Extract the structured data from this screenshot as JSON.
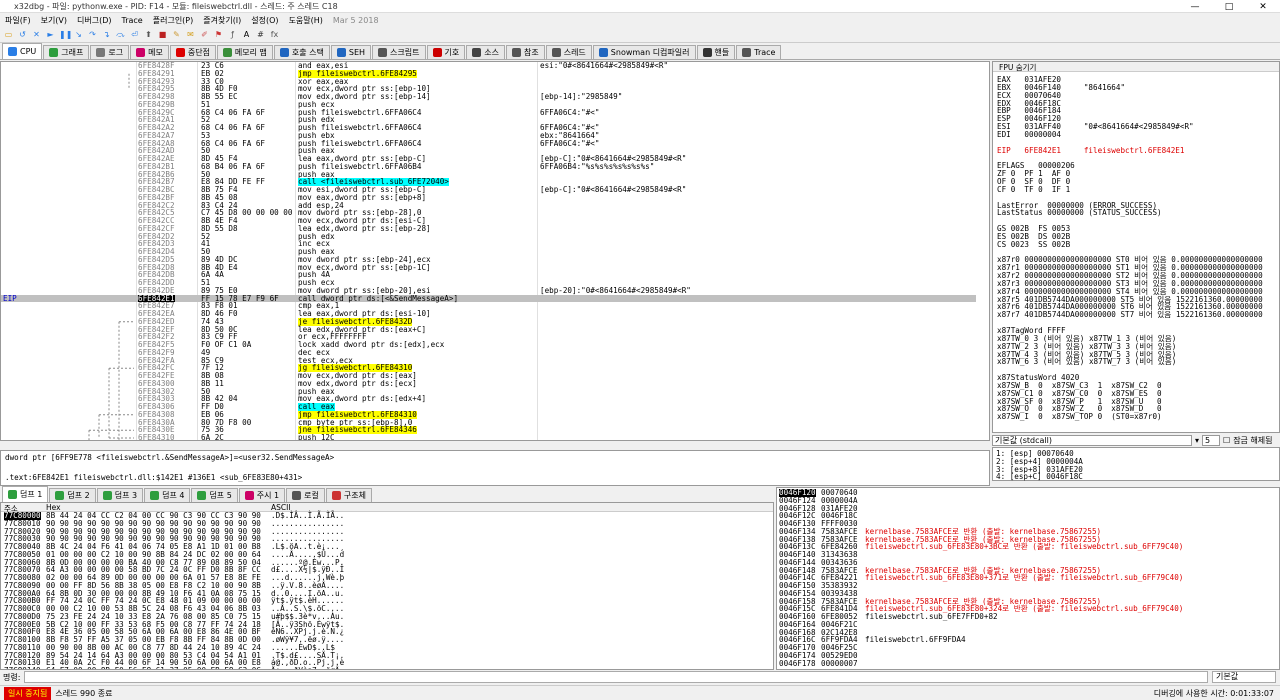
{
  "window": {
    "title": "x32dbg - 파일: pythonw.exe - PID: F14 - 모듈: fileiswebctrl.dll - 스레드: 주 스레드 C18",
    "controls": [
      "—",
      "□",
      "✕"
    ]
  },
  "menu": [
    "파일(F)",
    "보기(V)",
    "디버그(D)",
    "Trace",
    "플러그인(P)",
    "즐겨찾기(I)",
    "설정(O)",
    "도움말(H)",
    "Mar 5 2018"
  ],
  "toolbar_icons": [
    "open-icon",
    "restart-icon",
    "close-icon",
    "run-icon",
    "pause-icon",
    "step-into-icon",
    "step-over-icon",
    "trace-into-icon",
    "trace-over-icon",
    "execute-till-return-icon",
    "run-to-user-code-icon",
    "stop-icon",
    "patch-icon",
    "comment-icon",
    "label-icon",
    "bookmark-icon",
    "function-icon",
    "font-icon",
    "hash-icon",
    "fx-icon"
  ],
  "tabs": [
    {
      "label": "CPU",
      "color": "#2a7ee6"
    },
    {
      "label": "그래프",
      "color": "#2e9e3e"
    },
    {
      "label": "로그",
      "color": "#777"
    },
    {
      "label": "메모",
      "color": "#c06"
    },
    {
      "label": "중단점",
      "color": "#d00"
    },
    {
      "label": "메모리 맵",
      "color": "#3a8f3a"
    },
    {
      "label": "호출 스택",
      "color": "#2066c0"
    },
    {
      "label": "SEH",
      "color": "#2066c0"
    },
    {
      "label": "스크립트",
      "color": "#555"
    },
    {
      "label": "기호",
      "color": "#c00"
    },
    {
      "label": "소스",
      "color": "#444"
    },
    {
      "label": "참조",
      "color": "#555"
    },
    {
      "label": "스레드",
      "color": "#555"
    },
    {
      "label": "Snowman 디컴파일러",
      "color": "#2066c0"
    },
    {
      "label": "핸들",
      "color": "#333"
    },
    {
      "label": "Trace",
      "color": "#555"
    }
  ],
  "disasm": [
    [
      "6FE8428F",
      "23 C6",
      "and eax,esi",
      "esi:\"0#<8641664#<2985849#<R\"",
      ""
    ],
    [
      "6FE84291",
      "EB 02",
      "jmp fileiswebctrl.6FE84295",
      "",
      "hl"
    ],
    [
      "6FE84293",
      "33 C0",
      "xor eax,eax",
      "",
      ""
    ],
    [
      "6FE84295",
      "8B 4D F0",
      "mov ecx,dword ptr ss:[ebp-10]",
      "",
      ""
    ],
    [
      "6FE84298",
      "8B 55 EC",
      "mov edx,dword ptr ss:[ebp-14]",
      "[ebp-14]:\"2985849\"",
      ""
    ],
    [
      "6FE8429B",
      "51",
      "push ecx",
      "",
      ""
    ],
    [
      "6FE8429C",
      "68 C4 06 FA 6F",
      "push fileiswebctrl.6FFA06C4",
      "6FFA06C4:\"#<\"",
      ""
    ],
    [
      "6FE842A1",
      "52",
      "push edx",
      "",
      ""
    ],
    [
      "6FE842A2",
      "68 C4 06 FA 6F",
      "push fileiswebctrl.6FFA06C4",
      "6FFA06C4:\"#<\"",
      ""
    ],
    [
      "6FE842A7",
      "53",
      "push ebx",
      "ebx:\"8641664\"",
      ""
    ],
    [
      "6FE842A8",
      "68 C4 06 FA 6F",
      "push fileiswebctrl.6FFA06C4",
      "6FFA06C4:\"#<\"",
      ""
    ],
    [
      "6FE842AD",
      "50",
      "push eax",
      "",
      ""
    ],
    [
      "6FE842AE",
      "8D 45 F4",
      "lea eax,dword ptr ss:[ebp-C]",
      "[ebp-C]:\"0#<8641664#<2985849#<R\"",
      ""
    ],
    [
      "6FE842B1",
      "68 B4 06 FA 6F",
      "push fileiswebctrl.6FFA06B4",
      "6FFA06B4:\"%s%s%s%s%s%s%s\"",
      ""
    ],
    [
      "6FE842B6",
      "50",
      "push eax",
      "",
      ""
    ],
    [
      "6FE842B7",
      "E8 84 DD FE FF",
      "call <fileiswebctrl.sub_6FE72040>",
      "",
      "call"
    ],
    [
      "6FE842BC",
      "8B 75 F4",
      "mov esi,dword ptr ss:[ebp-C]",
      "[ebp-C]:\"0#<8641664#<2985849#<R\"",
      ""
    ],
    [
      "6FE842BF",
      "8B 45 08",
      "mov eax,dword ptr ss:[ebp+8]",
      "",
      ""
    ],
    [
      "6FE842C2",
      "83 C4 24",
      "add esp,24",
      "",
      ""
    ],
    [
      "6FE842C5",
      "C7 45 D8 00 00 00 00",
      "mov dword ptr ss:[ebp-28],0",
      "",
      ""
    ],
    [
      "6FE842CC",
      "8B 4E F4",
      "mov ecx,dword ptr ds:[esi-C]",
      "",
      ""
    ],
    [
      "6FE842CF",
      "8D 55 D8",
      "lea edx,dword ptr ss:[ebp-28]",
      "",
      ""
    ],
    [
      "6FE842D2",
      "52",
      "push edx",
      "",
      ""
    ],
    [
      "6FE842D3",
      "41",
      "inc ecx",
      "",
      ""
    ],
    [
      "6FE842D4",
      "50",
      "push eax",
      "",
      ""
    ],
    [
      "6FE842D5",
      "89 4D DC",
      "mov dword ptr ss:[ebp-24],ecx",
      "",
      ""
    ],
    [
      "6FE842D8",
      "8B 4D E4",
      "mov ecx,dword ptr ss:[ebp-1C]",
      "",
      ""
    ],
    [
      "6FE842DB",
      "6A 4A",
      "push 4A",
      "",
      ""
    ],
    [
      "6FE842DD",
      "51",
      "push ecx",
      "",
      ""
    ],
    [
      "6FE842DE",
      "89 75 E0",
      "mov dword ptr ss:[ebp-20],esi",
      "[ebp-20]:\"0#<8641664#<2985849#<R\"",
      ""
    ],
    [
      "6FE842E1",
      "FF 15 78 E7 F9 6F",
      "call dword ptr ds:[<&SendMessageA>]",
      "",
      "cur"
    ],
    [
      "6FE842E7",
      "83 F8 01",
      "cmp eax,1",
      "",
      ""
    ],
    [
      "6FE842EA",
      "8D 46 F0",
      "lea eax,dword ptr ds:[esi-10]",
      "",
      ""
    ],
    [
      "6FE842ED",
      "74 43",
      "je fileiswebctrl.6FE8432D",
      "",
      "hl"
    ],
    [
      "6FE842EF",
      "8D 50 0C",
      "lea edx,dword ptr ds:[eax+C]",
      "",
      ""
    ],
    [
      "6FE842F2",
      "83 C9 FF",
      "or ecx,FFFFFFFF",
      "",
      ""
    ],
    [
      "6FE842F5",
      "F0 OF C1 0A",
      "lock xadd dword ptr ds:[edx],ecx",
      "",
      ""
    ],
    [
      "6FE842F9",
      "49",
      "dec ecx",
      "",
      ""
    ],
    [
      "6FE842FA",
      "85 C9",
      "test ecx,ecx",
      "",
      ""
    ],
    [
      "6FE842FC",
      "7F 12",
      "jg fileiswebctrl.6FE84310",
      "",
      "hl"
    ],
    [
      "6FE842FE",
      "8B 08",
      "mov ecx,dword ptr ds:[eax]",
      "",
      ""
    ],
    [
      "6FE84300",
      "8B 11",
      "mov edx,dword ptr ds:[ecx]",
      "",
      ""
    ],
    [
      "6FE84302",
      "50",
      "push eax",
      "",
      ""
    ],
    [
      "6FE84303",
      "8B 42 04",
      "mov eax,dword ptr ds:[edx+4]",
      "",
      ""
    ],
    [
      "6FE84306",
      "FF D0",
      "call eax",
      "",
      "call"
    ],
    [
      "6FE84308",
      "EB 06",
      "jmp fileiswebctrl.6FE84310",
      "",
      "hl"
    ],
    [
      "6FE8430A",
      "80 7D F8 00",
      "cmp byte ptr ss:[ebp-8],0",
      "",
      ""
    ],
    [
      "6FE8430E",
      "75 36",
      "jne fileiswebctrl.6FE84346",
      "",
      "hl"
    ],
    [
      "6FE84310",
      "6A 2C",
      "push 12C",
      "",
      ""
    ],
    [
      "6FE84315",
      "FF 15 EC E3 F9 6F",
      "call dword ptr ds:[<&Sleep>]",
      "",
      "call"
    ],
    [
      "6FE8431B",
      "8B 45 E8",
      "mov eax,dword ptr ss:[ebp-18]",
      "",
      ""
    ],
    [
      "6FE8431E",
      "40",
      "inc eax",
      "",
      ""
    ]
  ],
  "eip_label": "EIP",
  "registers": {
    "header": "FPU 숨기기",
    "lines": [
      "EAX   031AFE20",
      "EBX   0046F140     \"8641664\"",
      "ECX   00070640",
      "EDX   0046F18C",
      "EBP   0046F184",
      "ESP   0046F120",
      "ESI   031AFF40     \"0#<8641664#<2985849#<R\"",
      "EDI   00000004",
      "",
      "EIP   6FE842E1     fileiswebctrl.6FE842E1",
      "",
      "EFLAGS   00000206",
      "ZF 0  PF 1  AF 0",
      "OF 0  SF 0  DF 0",
      "CF 0  TF 0  IF 1",
      "",
      "LastError  00000000 (ERROR_SUCCESS)",
      "LastStatus 00000000 (STATUS_SUCCESS)",
      "",
      "GS 002B  FS 0053",
      "ES 002B  DS 002B",
      "CS 0023  SS 002B",
      "",
      "x87r0 0000000000000000000 ST0 비어 있음 0.000000000000000000",
      "x87r1 0000000000000000000 ST1 비어 있음 0.000000000000000000",
      "x87r2 0000000000000000000 ST2 비어 있음 0.000000000000000000",
      "x87r3 0000000000000000000 ST3 비어 있음 0.000000000000000000",
      "x87r4 0000000000000000000 ST4 비어 있음 0.000000000000000000",
      "x87r5 401DB5744DA000000000 ST5 비어 있음 1522161360.00000000",
      "x87r6 401DB5744DA000000000 ST6 비어 있음 1522161360.00000000",
      "x87r7 401DB5744DA000000000 ST7 비어 있음 1522161360.00000000",
      "",
      "x87TagWord FFFF",
      "x87TW_0 3 (비어 있음) x87TW_1 3 (비어 있음)",
      "x87TW_2 3 (비어 있음) x87TW_3 3 (비어 있음)",
      "x87TW_4 3 (비어 있음) x87TW_5 3 (비어 있음)",
      "x87TW_6 3 (비어 있음) x87TW_7 3 (비어 있음)",
      "",
      "x87StatusWord 4020",
      "x87SW_B  0  x87SW_C3  1  x87SW_C2  0",
      "x87SW_C1 0  x87SW_C0  0  x87SW_ES  0",
      "x87SW_SF 0  x87SW_P   1  x87SW_U   0",
      "x87SW_O  0  x87SW_Z   0  x87SW_D   0",
      "x87SW_I  0  x87SW_TOP 0  (ST0=x87r0)"
    ]
  },
  "stack_combo": {
    "value": "기본값 (stdcall)",
    "count": "5",
    "lock_label": "잠금 해제됨"
  },
  "args": [
    "1: [esp] 00070640",
    "2: [esp+4] 0000004A",
    "3: [esp+8] 031AFE20",
    "4: [esp+C] 0046F18C"
  ],
  "info": {
    "line1": "dword ptr [6FF9E778 <fileiswebctrl.&SendMessageA>]=<user32.SendMessageA>",
    "line2": ".text:6FE842E1 fileiswebctrl.dll:$142E1 #136E1 <sub_6FE83E80+431>"
  },
  "dump_tabs": [
    "덤프 1",
    "덤프 2",
    "덤프 3",
    "덤프 4",
    "덤프 5",
    "주시 1",
    "로컬",
    "구조체"
  ],
  "dump_headers": {
    "addr": "주소",
    "hex": "Hex",
    "ascii": "ASCII"
  },
  "dump": [
    [
      "77C80000",
      "8B 44 24 04 CC C2 04 00 CC 90 C3 90 CC C3 90 90",
      ".D$.ÌÂ..Ì.Ã.ÌÃ.."
    ],
    [
      "77C80010",
      "90 90 90 90 90 90 90 90 90 90 90 90 90 90 90 90",
      "................"
    ],
    [
      "77C80020",
      "90 90 90 90 90 90 90 90 90 90 90 90 90 90 90 90",
      "................"
    ],
    [
      "77C80030",
      "90 90 90 90 90 90 90 90 90 90 90 90 90 90 90 90",
      "................"
    ],
    [
      "77C80040",
      "8B 4C 24 04 F6 41 04 06 74 05 E8 A1 1D 01 00 B8",
      ".L$.öA..t.è¡...¸"
    ],
    [
      "77C80050",
      "01 00 00 00 C2 10 00 90 8B 84 24 DC 02 00 00 64",
      "....Â.....$Ü...d"
    ],
    [
      "77C80060",
      "8B 0D 00 00 00 00 BA 40 00 C8 77 89 08 89 50 04",
      "......º@.Èw...P."
    ],
    [
      "77C80070",
      "64 A3 00 00 00 00 58 BD 7C 24 0C FF D0 8B 8F CC",
      "d£....X½|$.ÿÐ..Ì"
    ],
    [
      "77C80080",
      "02 00 00 64 89 0D 00 00 00 00 6A 01 57 E8 8E FE",
      "...d......j.Wè.þ"
    ],
    [
      "77C80090",
      "00 00 FF 8D 56 8B 38 05 00 E8 F8 C2 10 00 90 8B",
      "..ÿ.V.8..èøÂ...."
    ],
    [
      "77C800A0",
      "64 8B 0D 30 00 00 00 8B 49 10 F6 41 0A 08 75 15",
      "d..0....I.öA..u."
    ],
    [
      "77C800B0",
      "FF 74 24 0C FF 74 24 0C E8 48 01 09 00 00 00 00",
      "ÿt$.ÿt$.èH......"
    ],
    [
      "77C800C0",
      "00 00 C2 10 00 53 8B 5C 24 08 F6 43 04 06 8B 03",
      "..Â..S.\\$.öC...."
    ],
    [
      "77C800D0",
      "75 23 FE 24 24 10 33 E8 2A 76 08 00 85 C0 75 15",
      "u#þ$$.3è*v...Àu."
    ],
    [
      "77C800E0",
      "5B C2 10 00 FF 33 53 68 F5 00 C8 77 FF 74 24 18",
      "[Â..ÿ3Shõ.Èwÿt$."
    ],
    [
      "77C800F0",
      "E8 4E 36 05 00 58 50 6A 00 6A 00 E8 86 4E 00 BF",
      "èN6..XPj.j.è.N.¿"
    ],
    [
      "77C80100",
      "8B F8 57 FF A5 37 05 00 EB F8 8B FF 84 8B 0D 00",
      ".øWÿ¥7..ëø.ÿ...."
    ],
    [
      "77C80110",
      "00 90 00 8B 00 AC 00 C8 77 8D 44 24 10 89 4C 24",
      "......ÈwD$..L$"
    ],
    [
      "77C80120",
      "89 54 24 14 64 A3 00 00 00 80 53 C4 04 54 A1 01",
      ".T$.d£....SÄ.T¡."
    ],
    [
      "77C80130",
      "E1 40 0A 2C F0 44 00 6F 14 90 50 6A 00 6A 00 E8",
      "á@.,ðD.o..Pj.j.è"
    ],
    [
      "77C80140",
      "C4 F7 00 00 8B F0 56 E8 61 37 05 00 EB F8 C2 0C",
      "Ä÷...ðVèa7..ëøÂ."
    ]
  ],
  "stack": [
    [
      "0046F120",
      "00070640",
      "",
      ""
    ],
    [
      "0046F124",
      "0000004A",
      "",
      ""
    ],
    [
      "0046F128",
      "031AFE20",
      "",
      ""
    ],
    [
      "0046F12C",
      "0046F18C",
      "",
      ""
    ],
    [
      "0046F130",
      "FFFF0030",
      "",
      ""
    ],
    [
      "0046F134",
      "7583AFCE",
      "kernelbase.7583AFCE로 반환 (출발: kernelbase.75867255)",
      "red"
    ],
    [
      "0046F138",
      "7583AFCE",
      "kernelbase.7583AFCE로 반환 (출발: kernelbase.75867255)",
      "red"
    ],
    [
      "0046F13C",
      "6FE84260",
      "fileiswebctrl.sub_6FE83E80+3BC로 반환 (출발: fileiswebctrl.sub_6FF79C40)",
      "red"
    ],
    [
      "0046F140",
      "31343638",
      "",
      ""
    ],
    [
      "0046F144",
      "00343636",
      "",
      ""
    ],
    [
      "0046F148",
      "7583AFCE",
      "kernelbase.7583AFCE로 반환 (출발: kernelbase.75867255)",
      "red"
    ],
    [
      "0046F14C",
      "6FE84221",
      "fileiswebctrl.sub_6FE83E80+371로 반환 (출발: fileiswebctrl.sub_6FF79C40)",
      "red"
    ],
    [
      "0046F150",
      "35383932",
      "",
      ""
    ],
    [
      "0046F154",
      "00393438",
      "",
      ""
    ],
    [
      "0046F158",
      "7583AFCE",
      "kernelbase.7583AFCE로 반환 (출발: kernelbase.75867255)",
      "red"
    ],
    [
      "0046F15C",
      "6FE841D4",
      "fileiswebctrl.sub_6FE83E80+324로 반환 (출발: fileiswebctrl.sub_6FF79C40)",
      "red"
    ],
    [
      "0046F160",
      "6FE80052",
      "fileiswebctrl.sub_6FE7FFD0+82",
      ""
    ],
    [
      "0046F164",
      "0046F21C",
      "",
      ""
    ],
    [
      "0046F168",
      "02C142E8",
      "",
      ""
    ],
    [
      "0046F16C",
      "6FF9FDA4",
      "fileiswebctrl.6FF9FDA4",
      ""
    ],
    [
      "0046F170",
      "0046F25C",
      "",
      ""
    ],
    [
      "0046F174",
      "00529ED0",
      "",
      ""
    ],
    [
      "0046F178",
      "00000007",
      "",
      ""
    ]
  ],
  "cmd": {
    "label": "명령:",
    "mode": "기본값"
  },
  "status": {
    "paused": "일시 중지됨",
    "thread": "스레드 990 종료",
    "time": "디버깅에 사용한 시간: 0:01:33:07"
  }
}
